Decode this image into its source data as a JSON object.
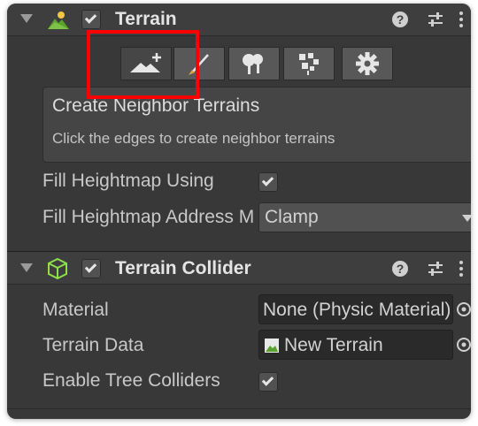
{
  "terrain_component": {
    "title": "Terrain",
    "enabled": true,
    "toolbar": {
      "buttons": [
        {
          "name": "create-neighbor-terrains-tool",
          "icon": "mountain-plus-icon",
          "active": true
        },
        {
          "name": "paint-terrain-tool",
          "icon": "brush-icon"
        },
        {
          "name": "paint-trees-tool",
          "icon": "trees-icon"
        },
        {
          "name": "paint-details-tool",
          "icon": "details-icon"
        },
        {
          "name": "terrain-settings-tool",
          "icon": "gear-icon"
        }
      ]
    },
    "help": {
      "title": "Create Neighbor Terrains",
      "text": "Click the edges to create neighbor terrains"
    },
    "fill_heightmap_using_label": "Fill Heightmap Using",
    "fill_heightmap_using_checked": true,
    "fill_heightmap_address_label": "Fill Heightmap Address Mode",
    "fill_heightmap_address_value": "Clamp"
  },
  "collider_component": {
    "title": "Terrain Collider",
    "enabled": true,
    "material_label": "Material",
    "material_value": "None (Physic Material)",
    "terrain_data_label": "Terrain Data",
    "terrain_data_value": "New Terrain",
    "enable_tree_colliders_label": "Enable Tree Colliders",
    "enable_tree_colliders_checked": true
  },
  "icons": {
    "help": "help-icon",
    "presets": "presets-icon",
    "menu": "more-vertical-icon",
    "object_picker": "object-picker-icon",
    "dropdown": "dropdown-arrow-icon"
  },
  "colors": {
    "panel_bg": "#383838",
    "header_bg": "#3e3e3e",
    "field_bg": "#2a2a2a",
    "highlight": "#ff0000",
    "collider_icon": "#8ee04a"
  }
}
